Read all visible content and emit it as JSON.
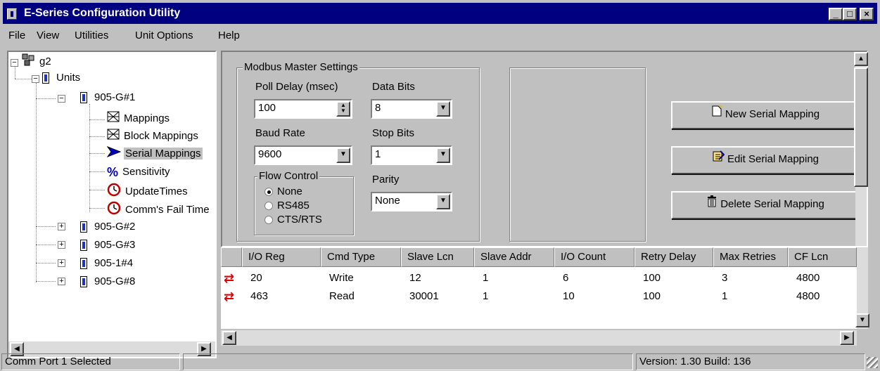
{
  "window": {
    "title": "E-Series Configuration Utility"
  },
  "menu": [
    "File",
    "View",
    "Utilities",
    "Unit Options",
    "Help"
  ],
  "tree": {
    "root": "g2",
    "units": "Units",
    "unit1": "905-G#1",
    "children": [
      "Mappings",
      "Block Mappings",
      "Serial Mappings",
      "Sensitivity",
      "UpdateTimes",
      "Comm's Fail Time"
    ],
    "other_units": [
      "905-G#2",
      "905-G#3",
      "905-1#4",
      "905-G#8"
    ]
  },
  "modbus": {
    "group_title": "Modbus Master Settings",
    "poll_delay_label": "Poll Delay (msec)",
    "poll_delay_value": "100",
    "data_bits_label": "Data Bits",
    "data_bits_value": "8",
    "baud_rate_label": "Baud Rate",
    "baud_rate_value": "9600",
    "stop_bits_label": "Stop Bits",
    "stop_bits_value": "1",
    "flow_control_title": "Flow Control",
    "flow_options": [
      "None",
      "RS485",
      "CTS/RTS"
    ],
    "flow_selected": "None",
    "parity_label": "Parity",
    "parity_value": "None"
  },
  "buttons": {
    "new": "New Serial Mapping",
    "edit": "Edit Serial Mapping",
    "delete": "Delete Serial Mapping"
  },
  "table": {
    "columns": [
      "I/O Reg",
      "Cmd Type",
      "Slave Lcn",
      "Slave Addr",
      "I/O Count",
      "Retry Delay",
      "Max Retries",
      "CF Lcn"
    ],
    "rows": [
      [
        "20",
        "Write",
        "12",
        "1",
        "6",
        "100",
        "3",
        "4800"
      ],
      [
        "463",
        "Read",
        "30001",
        "1",
        "10",
        "100",
        "1",
        "4800"
      ]
    ]
  },
  "status": {
    "left": "Comm Port 1 Selected",
    "middle": "",
    "right": "Version: 1.30 Build: 136"
  },
  "colors": {
    "titlebar": "#000080",
    "face": "#c0c0c0",
    "arrow": "#e00000"
  }
}
